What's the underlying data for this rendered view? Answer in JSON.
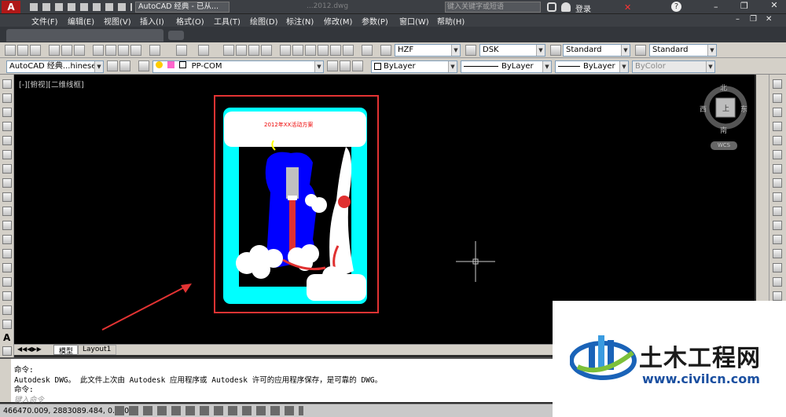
{
  "title": {
    "workspace": "AutoCAD 经典 - 已从...",
    "filename": "...2012.dwg",
    "search_placeholder": "键入关键字或短语",
    "login": "登录"
  },
  "menu": [
    "文件(F)",
    "编辑(E)",
    "视图(V)",
    "插入(I)",
    "格式(O)",
    "工具(T)",
    "绘图(D)",
    "标注(N)",
    "修改(M)",
    "参数(P)",
    "窗口(W)",
    "帮助(H)"
  ],
  "toolbar": {
    "text_style": "HZF",
    "dim_style": "DSK",
    "table_style": "Standard",
    "mleader_style": "Standard",
    "workspace_combo": "AutoCAD 经典...hinese 移",
    "layer": "PP-COM",
    "color": "ByLayer",
    "linetype": "ByLayer",
    "lineweight": "ByLayer",
    "plotstyle": "ByColor"
  },
  "viewport": {
    "label": "[-][俯视][二维线框]",
    "drawing_title": "2012年XX活动方案"
  },
  "viewcube": {
    "north": "北",
    "south": "南",
    "east": "东",
    "west": "西",
    "top": "上",
    "ucs": "WCS"
  },
  "layout_tabs": [
    "模型",
    "Layout1"
  ],
  "command": {
    "line1": "命令:",
    "line2": "Autodesk DWG。  此文件上次由 Autodesk 应用程序或 Autodesk 许可的应用程序保存，是可靠的 DWG。",
    "line3": "命令:",
    "placeholder": "键入命令"
  },
  "status": {
    "coords": "466470.009, 2883089.484, 0.000"
  },
  "watermark": {
    "name": "土木工程网",
    "url": "www.civilcn.com"
  },
  "colors": {
    "cyan": "#00ffff",
    "blue": "#0000ff",
    "red": "#e03030",
    "frame": "#e33333",
    "arrow": "#e33333"
  }
}
